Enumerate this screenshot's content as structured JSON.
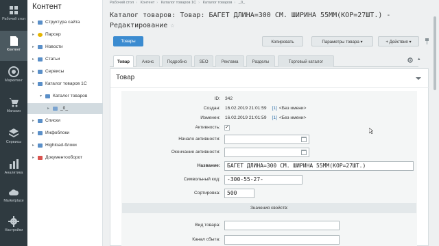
{
  "rail": [
    {
      "name": "rail-desktop",
      "label": "Рабочий стол",
      "icon": "desktop-icon"
    },
    {
      "name": "rail-content",
      "label": "Контент",
      "icon": "document-icon",
      "active": true
    },
    {
      "name": "rail-marketing",
      "label": "Маркетинг",
      "icon": "target-icon"
    },
    {
      "name": "rail-shop",
      "label": "Магазин",
      "icon": "cart-icon"
    },
    {
      "name": "rail-services",
      "label": "Сервисы",
      "icon": "layers-icon"
    },
    {
      "name": "rail-analytics",
      "label": "Аналитика",
      "icon": "bar-chart-icon"
    },
    {
      "name": "rail-marketplace",
      "label": "Marketplace",
      "icon": "cloud-icon"
    },
    {
      "name": "rail-settings",
      "label": "Настройки",
      "icon": "gear-icon"
    }
  ],
  "tree": {
    "title": "Контент",
    "items": [
      {
        "label": "Структура сайта",
        "icon": "folder-icon",
        "color": "#5a8fc8"
      },
      {
        "label": "Парсер",
        "icon": "parser-icon",
        "color": "#e4b400"
      },
      {
        "label": "Новости",
        "icon": "news-icon",
        "color": "#5a8fc8"
      },
      {
        "label": "Статьи",
        "icon": "articles-icon",
        "color": "#5a8fc8"
      },
      {
        "label": "Сервисы",
        "icon": "services-icon",
        "color": "#5a8fc8"
      },
      {
        "label": "Каталог товаров 1С",
        "icon": "catalog-icon",
        "color": "#5a8fc8"
      },
      {
        "label": "Каталог товаров",
        "icon": "catalog-icon",
        "color": "#5a8fc8"
      },
      {
        "label": "_0_",
        "icon": "folder-icon",
        "color": "#7aa3d0"
      },
      {
        "label": "Списки",
        "icon": "list-icon",
        "color": "#5a8fc8"
      },
      {
        "label": "Инфоблоки",
        "icon": "infoblock-icon",
        "color": "#5a8fc8"
      },
      {
        "label": "Highload-блоки",
        "icon": "highload-icon",
        "color": "#5a8fc8"
      },
      {
        "label": "Документооборот",
        "icon": "workflow-icon",
        "color": "#d9534f"
      }
    ]
  },
  "breadcrumb": [
    "Рабочий стол",
    "Контент",
    "Каталог товаров 1С",
    "Каталог товаров",
    "_0_"
  ],
  "page_title": "Каталог товаров: Товар: БАГЕТ ДЛИНА=300 СМ. ШИРИНА 55ММ(КОР=27ШТ.) - Редактирование",
  "toolbar": {
    "products": "Товары",
    "copy": "Копировать",
    "params": "Параметры товара",
    "actions": "+ Действия"
  },
  "tabs": [
    "Товар",
    "Анонс",
    "Подробно",
    "SEO",
    "Реклама",
    "Разделы",
    "Торговый каталог"
  ],
  "section_title": "Товар",
  "form": {
    "id_label": "ID:",
    "id_value": "342",
    "created_label": "Создан:",
    "created_value": "16.02.2019 21:01:59",
    "created_user_link": "[1]",
    "created_user": "<Без имени>",
    "modified_label": "Изменен:",
    "modified_value": "16.02.2019 21:01:59",
    "modified_user_link": "[1]",
    "modified_user": "<Без имени>",
    "active_label": "Активность:",
    "active_mark": "✓",
    "active_from_label": "Начало активности:",
    "active_to_label": "Окончание активности:",
    "name_label": "Название:",
    "name_value": "БАГЕТ ДЛИНА=300 СМ. ШИРИНА 55ММ(КОР=27ШТ.)",
    "code_label": "Символьный код:",
    "code_value": "-300-55-27-",
    "sort_label": "Сортировка:",
    "sort_value": "500",
    "props_header": "Значения свойств:",
    "product_type_label": "Вид товара:",
    "sales_channel_label": "Канал сбыта:"
  },
  "colors": {
    "rail_bg": "#2f3a40",
    "accent": "#3b8bd0",
    "tree_selected": "#d2dbe0"
  }
}
